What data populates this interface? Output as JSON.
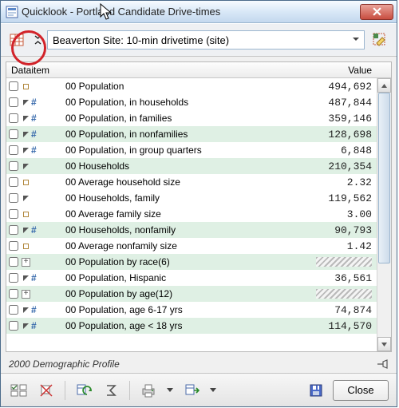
{
  "window": {
    "title": "Quicklook - Portland Candidate Drive-times"
  },
  "site_selector": {
    "label": "Beaverton Site: 10-min drivetime (site)"
  },
  "columns": {
    "item": "Dataitem",
    "value": "Value"
  },
  "rows": [
    {
      "kind": "dot",
      "hl": false,
      "label": "00 Population",
      "value": "494,692"
    },
    {
      "kind": "trihash",
      "hl": false,
      "label": "00 Population, in households",
      "value": "487,844"
    },
    {
      "kind": "trihash",
      "hl": false,
      "label": "00 Population, in families",
      "value": "359,146"
    },
    {
      "kind": "trihash",
      "hl": true,
      "label": "00 Population, in nonfamilies",
      "value": "128,698"
    },
    {
      "kind": "trihash",
      "hl": false,
      "label": "00 Population, in group quarters",
      "value": "6,848"
    },
    {
      "kind": "tri",
      "hl": true,
      "label": "00 Households",
      "value": "210,354"
    },
    {
      "kind": "dot",
      "hl": false,
      "label": "00 Average household size",
      "value": "2.32"
    },
    {
      "kind": "tri",
      "hl": false,
      "label": "00 Households, family",
      "value": "119,562"
    },
    {
      "kind": "dot",
      "hl": false,
      "label": "00 Average family size",
      "value": "3.00"
    },
    {
      "kind": "trihash",
      "hl": true,
      "label": "00 Households, nonfamily",
      "value": "90,793"
    },
    {
      "kind": "dot",
      "hl": false,
      "label": "00 Average nonfamily size",
      "value": "1.42"
    },
    {
      "kind": "plus",
      "hl": true,
      "label": "00 Population by race(6)",
      "value": null
    },
    {
      "kind": "trihash",
      "hl": false,
      "label": "00 Population, Hispanic",
      "value": "36,561"
    },
    {
      "kind": "plus",
      "hl": true,
      "label": "00 Population by age(12)",
      "value": null
    },
    {
      "kind": "trihash",
      "hl": false,
      "label": "00 Population, age 6-17 yrs",
      "value": "74,874"
    },
    {
      "kind": "trihash",
      "hl": true,
      "label": "00 Population, age < 18 yrs",
      "value": "114,570"
    }
  ],
  "status": "2000 Demographic Profile",
  "buttons": {
    "close": "Close"
  },
  "icons": {
    "quicklook": "quicklook-icon",
    "site_tool": "data-grid-icon",
    "select_tool": "select-highlight-icon"
  }
}
